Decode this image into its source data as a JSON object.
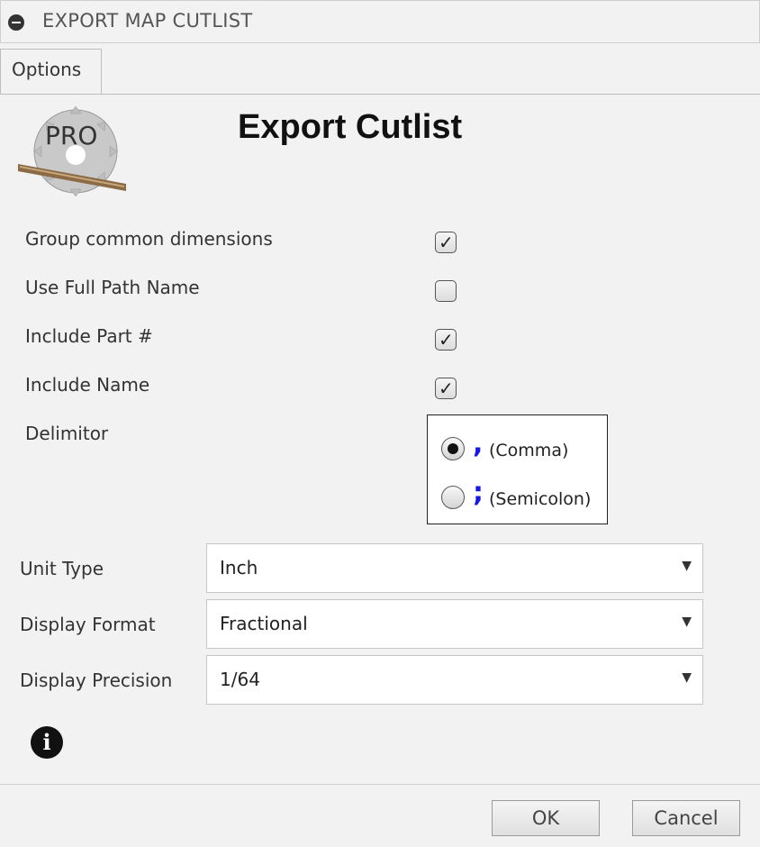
{
  "window": {
    "title": "EXPORT MAP CUTLIST",
    "collapse_icon": "minus-circle-icon"
  },
  "tabs": [
    {
      "label": "Options",
      "active": true
    }
  ],
  "logo": {
    "text": "PRO",
    "icon": "saw-blade-icon"
  },
  "heading": "Export Cutlist",
  "options": [
    {
      "label": "Group common dimensions",
      "checked": true
    },
    {
      "label": "Use Full Path Name",
      "checked": false
    },
    {
      "label": "Include Part #",
      "checked": true
    },
    {
      "label": "Include Name",
      "checked": true
    }
  ],
  "delimiter": {
    "label": "Delimitor",
    "choices": [
      {
        "char": ",",
        "label": "(Comma)",
        "selected": true
      },
      {
        "char": ";",
        "label": "(Semicolon)",
        "selected": false
      }
    ]
  },
  "selects": [
    {
      "label": "Unit Type",
      "value": "Inch"
    },
    {
      "label": "Display Format",
      "value": "Fractional"
    },
    {
      "label": "Display Precision",
      "value": "1/64"
    }
  ],
  "info_icon": "info-icon",
  "buttons": {
    "ok": "OK",
    "cancel": "Cancel"
  },
  "colors": {
    "delimiter_char": "#1a1ad6",
    "background": "#f2f2f2"
  }
}
